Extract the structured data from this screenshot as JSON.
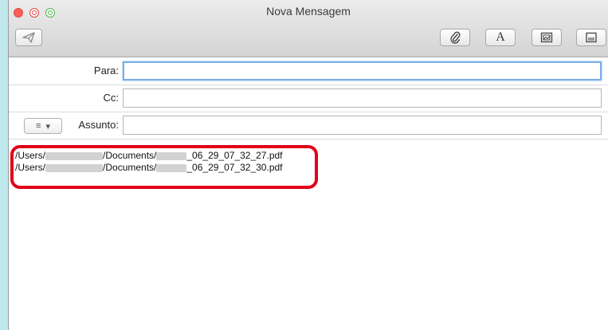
{
  "window": {
    "title": "Nova Mensagem"
  },
  "toolbar": {
    "send": "send-icon",
    "attach": "paperclip-icon",
    "font": "A",
    "photo": "photo-browser-icon",
    "format": "stationery-icon"
  },
  "fields": {
    "to_label": "Para:",
    "to_value": "",
    "cc_label": "Cc:",
    "cc_value": "",
    "subject_label": "Assunto:",
    "subject_value": "",
    "menu_symbol": "≡",
    "menu_arrow": "▾"
  },
  "body": {
    "lines": [
      {
        "prefix": "/Users/",
        "middle": "/Documents/",
        "suffix": "_06_29_07_32_27.pdf"
      },
      {
        "prefix": "/Users/",
        "middle": "/Documents/",
        "suffix": "_06_29_07_32_30.pdf"
      }
    ]
  },
  "colors": {
    "highlight": "#e0001a",
    "focus": "#7aaee9",
    "background": "#bfe8ec"
  }
}
